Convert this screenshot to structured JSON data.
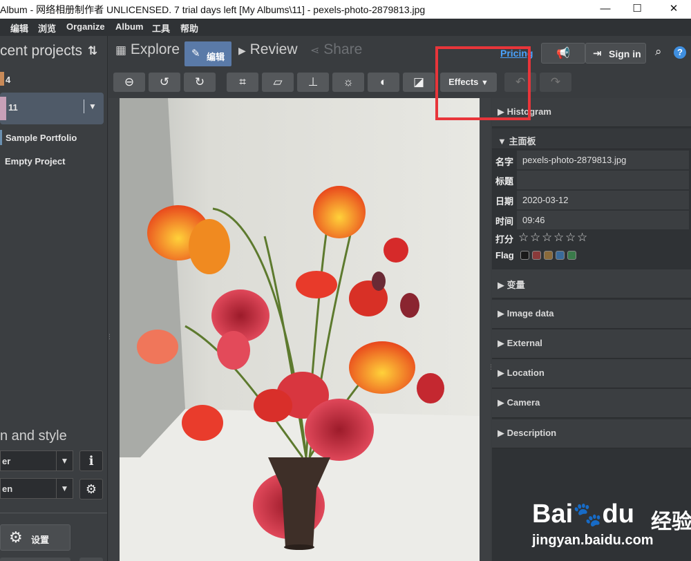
{
  "window": {
    "title": "Album - 网络相册制作者 UNLICENSED. 7 trial days left [My Albums\\11] - pexels-photo-2879813.jpg",
    "minimize": "—",
    "maximize": "☐",
    "close": "✕"
  },
  "menu": [
    "编辑",
    "浏览",
    "Organize",
    "Album",
    "工具",
    "帮助"
  ],
  "left": {
    "header": "cent projects",
    "projects": [
      {
        "label": "4"
      },
      {
        "label": "11"
      },
      {
        "label": "Sample Portfolio"
      },
      {
        "label": "Empty Project"
      }
    ],
    "section_title": "n and style",
    "select1": "er",
    "select2": "en",
    "settings_label": "设置"
  },
  "nav": {
    "explore": "Explore",
    "edit": "编辑",
    "review": "Review",
    "share": "Share",
    "pricing": "Pricing",
    "signin": "Sign in"
  },
  "toolbar": {
    "effects": "Effects"
  },
  "panel": {
    "histogram": "Histogram",
    "main": "主面板",
    "name_label": "名字",
    "name_value": "pexels-photo-2879813.jpg",
    "title_label": "标题",
    "title_value": "",
    "date_label": "日期",
    "date_value": "2020-03-12",
    "time_label": "时间",
    "time_value": "09:46",
    "rating_label": "打分",
    "rating": 0,
    "flag_label": "Flag",
    "flag_colors": [
      "#1a1a1a",
      "#8a3a3a",
      "#8a6a3a",
      "#3a6a9a",
      "#3a7a4a"
    ],
    "sections": [
      "变量",
      "Image data",
      "External",
      "Location",
      "Camera",
      "Description"
    ]
  },
  "watermark": {
    "brand": "Bai",
    "brand2": "du",
    "cn": "经验",
    "url": "jingyan.baidu.com"
  },
  "colors": {
    "accent": "#5a7aa8",
    "link": "#4aa3ff",
    "highlight_box": "#e8353a"
  }
}
